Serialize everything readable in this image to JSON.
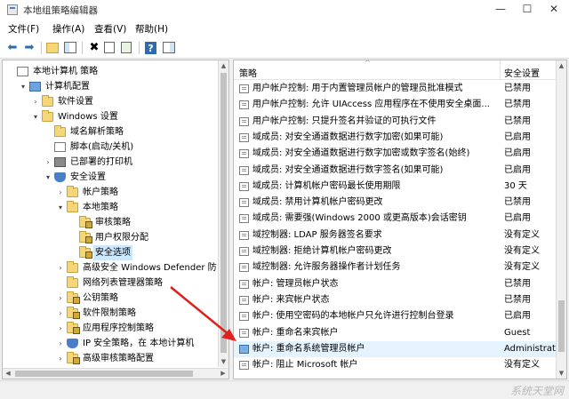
{
  "window": {
    "title": "本地组策略编辑器",
    "controls": [
      "minimize",
      "maximize",
      "close"
    ]
  },
  "menu": [
    "文件(F)",
    "操作(A)",
    "查看(V)",
    "帮助(H)"
  ],
  "toolbar_icons": [
    "back-arrow-icon",
    "forward-arrow-icon",
    "up-folder-icon",
    "show-tree-icon",
    "delete-icon",
    "properties-icon",
    "export-list-icon",
    "help-icon",
    "action-pane-icon"
  ],
  "tree": [
    {
      "label": "本地计算机 策略",
      "level": 0,
      "toggle": "",
      "icon": "doc"
    },
    {
      "label": "计算机配置",
      "level": 1,
      "toggle": "▾",
      "icon": "pc"
    },
    {
      "label": "软件设置",
      "level": 2,
      "toggle": "›",
      "icon": "folder"
    },
    {
      "label": "Windows 设置",
      "level": 2,
      "toggle": "▾",
      "icon": "folder"
    },
    {
      "label": "域名解析策略",
      "level": 3,
      "toggle": "",
      "icon": "folder"
    },
    {
      "label": "脚本(启动/关机)",
      "level": 3,
      "toggle": "",
      "icon": "doc"
    },
    {
      "label": "已部署的打印机",
      "level": 3,
      "toggle": "›",
      "icon": "printer"
    },
    {
      "label": "安全设置",
      "level": 3,
      "toggle": "▾",
      "icon": "shield"
    },
    {
      "label": "帐户策略",
      "level": 4,
      "toggle": "›",
      "icon": "folder"
    },
    {
      "label": "本地策略",
      "level": 4,
      "toggle": "▾",
      "icon": "folder"
    },
    {
      "label": "审核策略",
      "level": 5,
      "toggle": "",
      "icon": "folder"
    },
    {
      "label": "用户权限分配",
      "level": 5,
      "toggle": "",
      "icon": "folder"
    },
    {
      "label": "安全选项",
      "level": 5,
      "toggle": "",
      "icon": "folder",
      "selected": true
    },
    {
      "label": "高级安全 Windows Defender 防",
      "level": 4,
      "toggle": "›",
      "icon": "folder"
    },
    {
      "label": "网络列表管理器策略",
      "level": 4,
      "toggle": "",
      "icon": "folder"
    },
    {
      "label": "公钥策略",
      "level": 4,
      "toggle": "›",
      "icon": "folder"
    },
    {
      "label": "软件限制策略",
      "level": 4,
      "toggle": "›",
      "icon": "folder"
    },
    {
      "label": "应用程序控制策略",
      "level": 4,
      "toggle": "›",
      "icon": "folder"
    },
    {
      "label": "IP 安全策略，在 本地计算机",
      "level": 4,
      "toggle": "›",
      "icon": "shield"
    },
    {
      "label": "高级审核策略配置",
      "level": 4,
      "toggle": "›",
      "icon": "folder"
    }
  ],
  "list": {
    "columns": {
      "policy": "策略",
      "setting": "安全设置"
    },
    "rows": [
      {
        "name": "用户帐户控制: 用于内置管理员帐户的管理员批准模式",
        "value": "已禁用"
      },
      {
        "name": "用户帐户控制: 允许 UIAccess 应用程序在不使用安全桌面...",
        "value": "已禁用"
      },
      {
        "name": "用户帐户控制: 只提升签名并验证的可执行文件",
        "value": "已禁用"
      },
      {
        "name": "域成员: 对安全通道数据进行数字加密(如果可能)",
        "value": "已启用"
      },
      {
        "name": "域成员: 对安全通道数据进行数字加密或数字签名(始终)",
        "value": "已启用"
      },
      {
        "name": "域成员: 对安全通道数据进行数字签名(如果可能)",
        "value": "已启用"
      },
      {
        "name": "域成员: 计算机帐户密码最长使用期限",
        "value": "30 天"
      },
      {
        "name": "域成员: 禁用计算机帐户密码更改",
        "value": "已禁用"
      },
      {
        "name": "域成员: 需要强(Windows 2000 或更高版本)会话密钥",
        "value": "已启用"
      },
      {
        "name": "域控制器: LDAP 服务器签名要求",
        "value": "没有定义"
      },
      {
        "name": "域控制器: 拒绝计算机帐户密码更改",
        "value": "没有定义"
      },
      {
        "name": "域控制器: 允许服务器操作者计划任务",
        "value": "没有定义"
      },
      {
        "name": "帐户: 管理员帐户状态",
        "value": "已禁用"
      },
      {
        "name": "帐户: 来宾帐户状态",
        "value": "已禁用"
      },
      {
        "name": "帐户: 使用空密码的本地帐户只允许进行控制台登录",
        "value": "已启用"
      },
      {
        "name": "帐户: 重命名来宾帐户",
        "value": "Guest"
      },
      {
        "name": "帐户: 重命名系统管理员帐户",
        "value": "Administrat",
        "highlight": true
      },
      {
        "name": "帐户: 阻止 Microsoft 帐户",
        "value": "没有定义"
      }
    ]
  },
  "watermark": "系统天堂网",
  "colors": {
    "selection": "#cce8ff",
    "row_highlight": "#e5f3ff",
    "annotation_arrow": "#e0201c"
  }
}
